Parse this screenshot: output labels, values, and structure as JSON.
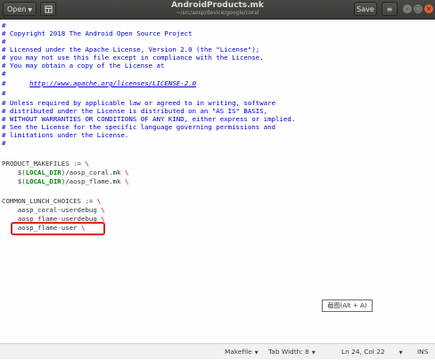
{
  "header": {
    "open_label": "Open",
    "open_caret": "▼",
    "bookmark_icon": "document-icon",
    "title": "AndroidProducts.mk",
    "path": "~/src/aosp/device/google/coral",
    "save_label": "Save",
    "menu_icon": "≡",
    "window_controls": [
      "minimize-icon",
      "maximize-icon",
      "close-icon"
    ]
  },
  "editor": {
    "lines": {
      "l1": "#",
      "l2": "# Copyright 2018 The Android Open Source Project",
      "l3": "#",
      "l4": "# Licensed under the Apache License, Version 2.0 (the \"License\");",
      "l5": "# you may not use this file except in compliance with the License.",
      "l6": "# You may obtain a copy of the License at",
      "l7": "#",
      "l8_prefix": "#      ",
      "l8_url": "http://www.apache.org/licenses/LICENSE-2.0",
      "l9": "#",
      "l10": "# Unless required by applicable law or agreed to in writing, software",
      "l11": "# distributed under the License is distributed on an \"AS IS\" BASIS,",
      "l12": "# WITHOUT WARRANTIES OR CONDITIONS OF ANY KIND, either express or implied.",
      "l13": "# See the License for the specific language governing permissions and",
      "l14": "# limitations under the License.",
      "l15": "#",
      "l16": "",
      "l17": "PRODUCT_MAKEFILES := ",
      "l18_a": "    $(",
      "l18_var": "LOCAL_DIR",
      "l18_b": ")/aosp_coral.mk ",
      "l19_a": "    $(",
      "l19_var": "LOCAL_DIR",
      "l19_b": ")/aosp_flame.mk ",
      "l20": "",
      "l21": "COMMON_LUNCH_CHOICES := ",
      "l22": "    aosp_coral-userdebug ",
      "l23": "    aosp_flame-userdebug ",
      "l24": "    aosp_flame-user ",
      "backslash": "\\"
    }
  },
  "tooltip": "截图(Alt + A)",
  "status": {
    "language": "Makefile",
    "tab_width": "Tab Width: 8",
    "position": "Ln 24, Col 22",
    "mode": "INS",
    "caret": "▼"
  }
}
